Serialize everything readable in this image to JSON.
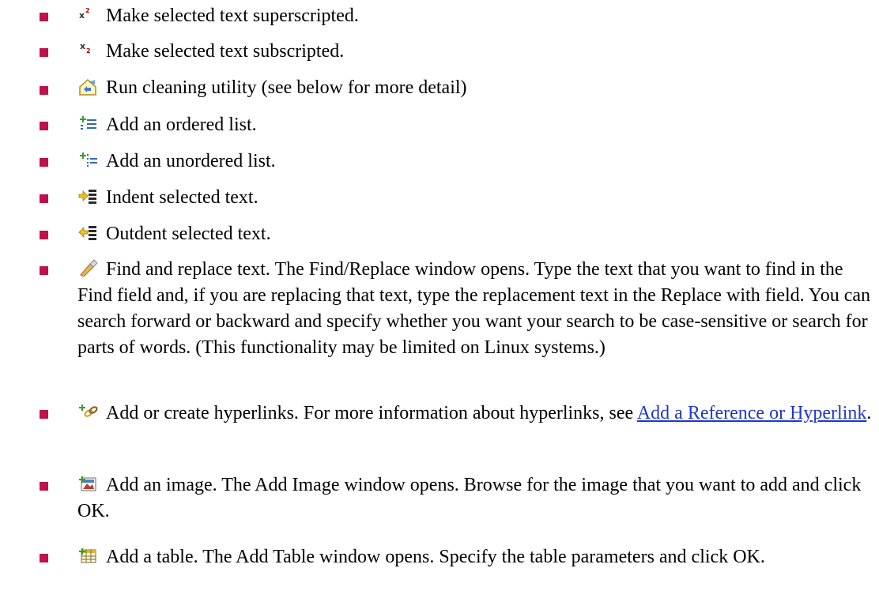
{
  "colors": {
    "bullet": "#c0114b",
    "link": "#1f38c8",
    "text": "#000000"
  },
  "items": [
    {
      "icon": "superscript-icon",
      "text": "Make selected text superscripted."
    },
    {
      "icon": "subscript-icon",
      "text": "Make selected text subscripted."
    },
    {
      "icon": "cleaning-utility-icon",
      "text": "Run cleaning utility (see below for more detail)"
    },
    {
      "icon": "ordered-list-icon",
      "text": "Add an ordered list."
    },
    {
      "icon": "unordered-list-icon",
      "text": "Add an unordered list."
    },
    {
      "icon": "indent-icon",
      "text": "Indent selected text."
    },
    {
      "icon": "outdent-icon",
      "text": "Outdent selected text."
    },
    {
      "icon": "find-replace-icon",
      "text": "Find and replace text.  The Find/Replace window opens.  Type the text that you want to find in the Find field and, if you are replacing that text, type the replacement text in the Replace with field.  You can search forward or backward and specify whether you want your search to be case-sensitive or search for parts of words.  (This functionality may be limited on Linux systems.)"
    },
    {
      "icon": "hyperlink-icon",
      "text": "Add or create hyperlinks.  For more information about hyperlinks, see ",
      "link": "Add a Reference or Hyperlink",
      "after": "."
    },
    {
      "icon": "add-image-icon",
      "text": "Add an image.  The Add Image window opens.  Browse for the image that you want to add and click OK."
    },
    {
      "icon": "add-table-icon",
      "text": "Add a table.  The Add Table window opens.  Specify the table parameters and click OK."
    }
  ]
}
